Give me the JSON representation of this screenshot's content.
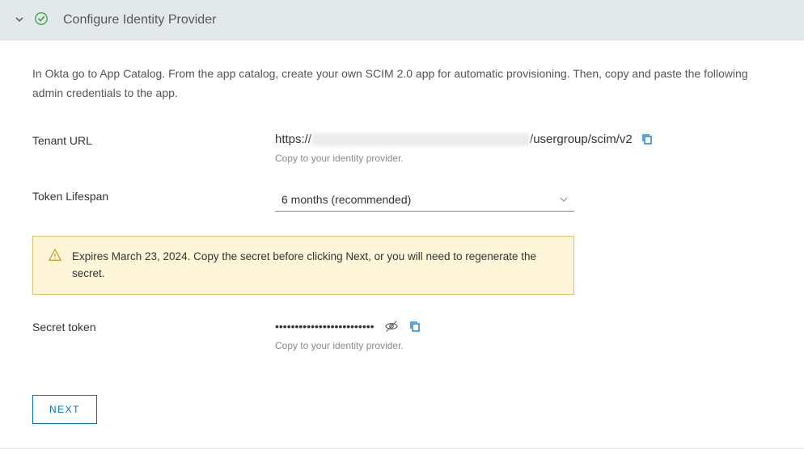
{
  "header": {
    "title": "Configure Identity Provider"
  },
  "intro": "In Okta go to App Catalog. From the app catalog, create your own SCIM 2.0 app for automatic provisioning. Then, copy and paste the following admin credentials to the app.",
  "tenant": {
    "label": "Tenant URL",
    "url_prefix": "https://",
    "url_suffix": "/usergroup/scim/v2",
    "helper": "Copy to your identity provider."
  },
  "lifespan": {
    "label": "Token Lifespan",
    "selected": "6 months (recommended)"
  },
  "alert": {
    "text": "Expires March 23, 2024. Copy the secret before clicking Next, or you will need to regenerate the secret."
  },
  "secret": {
    "label": "Secret token",
    "masked": "•••••••••••••••••••••••••",
    "helper": "Copy to your identity provider."
  },
  "buttons": {
    "next": "NEXT"
  }
}
